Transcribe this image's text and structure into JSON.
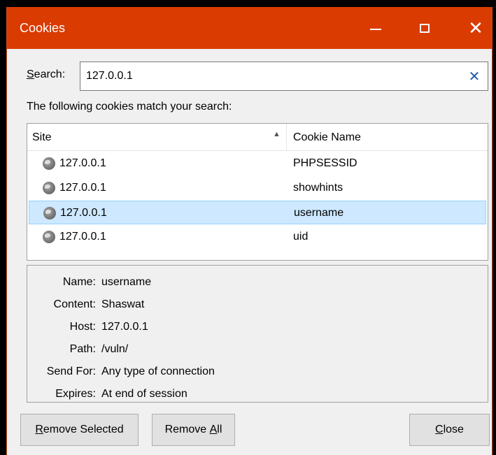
{
  "window": {
    "title": "Cookies",
    "minimize_glyph": "—",
    "maximize_glyph": "☐",
    "close_glyph": "✕"
  },
  "search": {
    "label_hotkey": "S",
    "label_rest": "earch:",
    "value": "127.0.0.1",
    "clear_glyph": "✕"
  },
  "match_text": "The following cookies match your search:",
  "list": {
    "columns": {
      "site": "Site",
      "cookie_name": "Cookie Name",
      "sort_glyph": "▲"
    },
    "rows": [
      {
        "site": "127.0.0.1",
        "name": "PHPSESSID",
        "selected": false
      },
      {
        "site": "127.0.0.1",
        "name": "showhints",
        "selected": false
      },
      {
        "site": "127.0.0.1",
        "name": "username",
        "selected": true
      },
      {
        "site": "127.0.0.1",
        "name": "uid",
        "selected": false
      }
    ]
  },
  "details": [
    {
      "label": "Name:",
      "value": "username"
    },
    {
      "label": "Content:",
      "value": "Shaswat"
    },
    {
      "label": "Host:",
      "value": "127.0.0.1"
    },
    {
      "label": "Path:",
      "value": "/vuln/"
    },
    {
      "label": "Send For:",
      "value": "Any type of connection"
    },
    {
      "label": "Expires:",
      "value": "At end of session"
    }
  ],
  "buttons": {
    "remove_selected_hotkey": "R",
    "remove_selected_rest": "emove Selected",
    "remove_all_prefix": "Remove ",
    "remove_all_hotkey": "A",
    "remove_all_rest": "ll",
    "close_hotkey": "C",
    "close_rest": "lose"
  },
  "colors": {
    "titlebar": "#da3b01",
    "selection": "#cde8ff",
    "clear_icon": "#1e5aa8"
  }
}
